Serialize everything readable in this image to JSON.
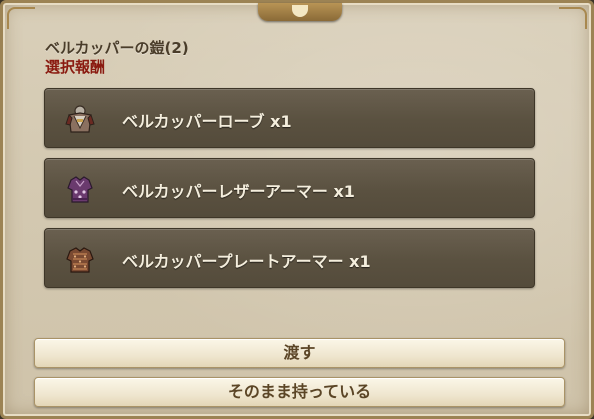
{
  "dialog": {
    "title": "ベルカッパーの鎧(2)",
    "subtitle": "選択報酬"
  },
  "rewards": [
    {
      "label": "ベルカッパーローブ x1",
      "icon": "robe-icon"
    },
    {
      "label": "ベルカッパーレザーアーマー x1",
      "icon": "leather-armor-icon"
    },
    {
      "label": "ベルカッパープレートアーマー x1",
      "icon": "plate-armor-icon"
    }
  ],
  "buttons": {
    "give": "渡す",
    "keep": "そのまま持っている"
  },
  "colors": {
    "panel_bg": "#d6cbb3",
    "reward_bg": "#5c5342",
    "title_text": "#4a3d2a",
    "subtitle_text": "#8a1a10",
    "button_text": "#5b4526"
  }
}
